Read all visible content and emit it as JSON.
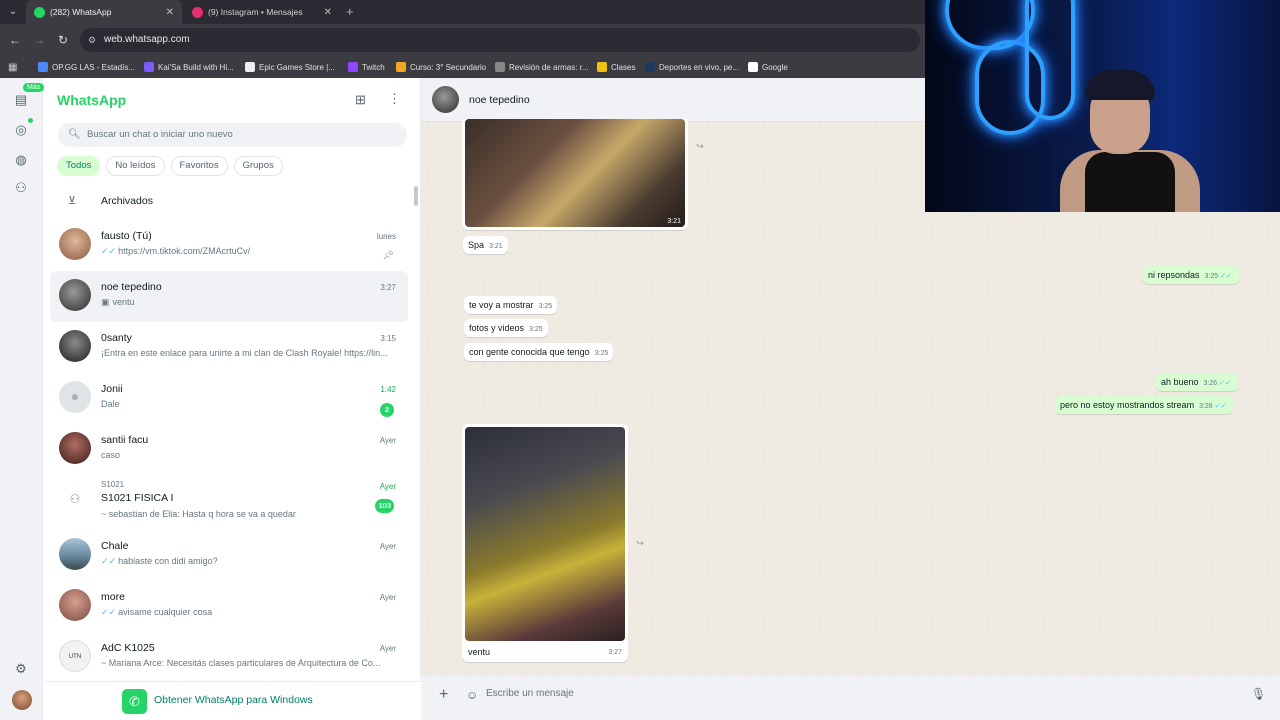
{
  "browser": {
    "tabs": [
      {
        "title": "(282) WhatsApp",
        "favicon_color": "#25d366",
        "active": true
      },
      {
        "title": "(9) Instagram • Mensajes",
        "favicon_color": "#e1306c",
        "active": false
      }
    ],
    "url": "web.whatsapp.com",
    "bookmarks": [
      {
        "label": "OP.GG LAS - Estadís...",
        "color": "#4c8bf5"
      },
      {
        "label": "Kai'Sa Build with Hi...",
        "color": "#7a5cff"
      },
      {
        "label": "Epic Games Store |...",
        "color": "#eeeeee"
      },
      {
        "label": "Twitch",
        "color": "#9146ff"
      },
      {
        "label": "Curso: 3° Secundario",
        "color": "#f5a623"
      },
      {
        "label": "Revisión de armas: r...",
        "color": "#888888"
      },
      {
        "label": "Clases",
        "color": "#f4c20d"
      },
      {
        "label": "Deportes en vivo, pe...",
        "color": "#1f3a5f"
      },
      {
        "label": "Google",
        "color": "#ffffff"
      }
    ]
  },
  "rail": {
    "badge": "Más"
  },
  "sidebar": {
    "title": "WhatsApp",
    "search_placeholder": "Buscar un chat o iniciar uno nuevo",
    "filters": [
      "Todos",
      "No leídos",
      "Favoritos",
      "Grupos"
    ],
    "archived_label": "Archivados",
    "chats": [
      {
        "name": "fausto (Tú)",
        "snippet": "https://vm.tiktok.com/ZMAcrtuCv/",
        "time": "lunes",
        "ticks": true,
        "pinned": true,
        "avatar": "#c89a7a"
      },
      {
        "name": "noe tepedino",
        "snippet": "ventu",
        "time": "3:27",
        "photo": true,
        "selected": true,
        "avatar": "#555555"
      },
      {
        "name": "0santy",
        "snippet": "¡Entra en este enlace para unirte a mi clan de Clash Royale! https://lin...",
        "time": "3:15",
        "avatar": "#3a3a3a"
      },
      {
        "name": "Jonii",
        "snippet": "Dale",
        "time": "1:42",
        "unread": "2",
        "generic": true
      },
      {
        "name": "santii facu",
        "snippet": "caso",
        "time": "Ayer",
        "avatar": "#6a3a3a"
      },
      {
        "name": "S1021 FISICA I",
        "group_tag": "S1021",
        "snippet": "~ sebastian de Elia: Hasta q hora se va a quedar",
        "time": "Ayer",
        "unread": "103",
        "group": true
      },
      {
        "name": "Chale",
        "snippet": "hablaste con didi amigo?",
        "time": "Ayer",
        "ticks": true,
        "avatar": "#7a9ab0"
      },
      {
        "name": "more",
        "snippet": "avisame cualquier cosa",
        "time": "Ayer",
        "ticks": true,
        "avatar": "#b07a6a"
      },
      {
        "name": "AdC K1025",
        "snippet": "~ Mariana Arce: Necesitás clases particulares de Arquitectura de Co...",
        "time": "Ayer",
        "avatar": "#eeeeee"
      }
    ],
    "promo": "Obtener WhatsApp para Windows"
  },
  "chat": {
    "contact": "noe tepedino",
    "messages": [
      {
        "kind": "photo",
        "time": "3:21"
      },
      {
        "kind": "in",
        "text": "Spa",
        "time": "3:21"
      },
      {
        "kind": "out",
        "text": "ni repsondas",
        "time": "3:25"
      },
      {
        "kind": "in",
        "text": "te voy a mostrar",
        "time": "3:25"
      },
      {
        "kind": "in",
        "text": "fotos y videos",
        "time": "3:25"
      },
      {
        "kind": "in",
        "text": "con gente conocida que tengo",
        "time": "3:25"
      },
      {
        "kind": "out",
        "text": "ah bueno",
        "time": "3:26"
      },
      {
        "kind": "out",
        "text": "pero no estoy mostrandos stream",
        "time": "3:26"
      },
      {
        "kind": "photo",
        "caption": "ventu",
        "time": "3:27"
      }
    ],
    "composer_placeholder": "Escribe un mensaje"
  }
}
